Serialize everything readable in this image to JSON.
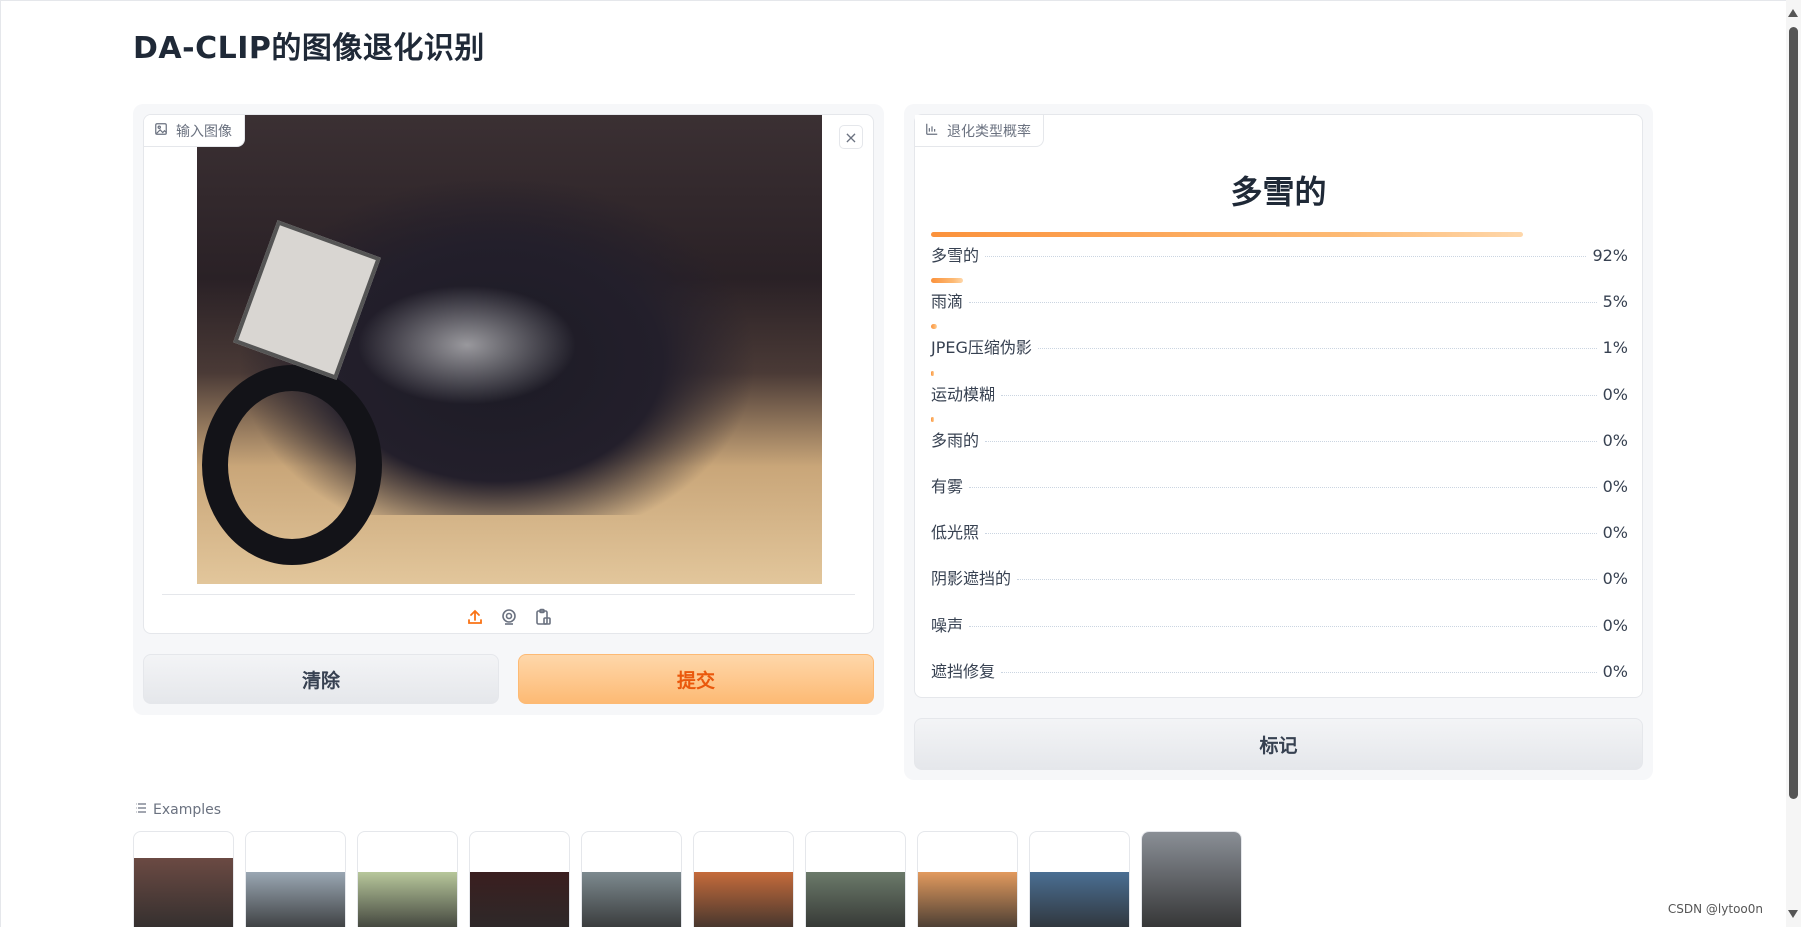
{
  "app": {
    "title": "DA-CLIP的图像退化识别"
  },
  "input": {
    "label": "输入图像",
    "close_symbol": "×",
    "icons": [
      "image-icon",
      "upload-icon",
      "webcam-icon",
      "clipboard-icon"
    ]
  },
  "buttons": {
    "clear": "清除",
    "submit": "提交",
    "flag": "标记"
  },
  "output": {
    "label": "退化类型概率",
    "top_label": "多雪的",
    "rows": [
      {
        "name": "多雪的",
        "percent": "92%",
        "value": 0.92
      },
      {
        "name": "雨滴",
        "percent": "5%",
        "value": 0.05
      },
      {
        "name": "JPEG压缩伪影",
        "percent": "1%",
        "value": 0.01
      },
      {
        "name": "运动模糊",
        "percent": "0%",
        "value": 0.004
      },
      {
        "name": "多雨的",
        "percent": "0%",
        "value": 0.003
      },
      {
        "name": "有雾",
        "percent": "0%",
        "value": 0
      },
      {
        "name": "低光照",
        "percent": "0%",
        "value": 0
      },
      {
        "name": "阴影遮挡的",
        "percent": "0%",
        "value": 0
      },
      {
        "name": "噪声",
        "percent": "0%",
        "value": 0
      },
      {
        "name": "遮挡修复",
        "percent": "0%",
        "value": 0
      }
    ]
  },
  "examples": {
    "label": "Examples",
    "thumbs": [
      {
        "name": "example-face",
        "color": "#6b4a43"
      },
      {
        "name": "example-palace",
        "color": "#9aa7b3"
      },
      {
        "name": "example-grass",
        "color": "#b7c79b"
      },
      {
        "name": "example-dark",
        "color": "#3a1e1f"
      },
      {
        "name": "example-street",
        "color": "#7d8a8f"
      },
      {
        "name": "example-stairs",
        "color": "#c56b3b"
      },
      {
        "name": "example-blur",
        "color": "#6b7a6a"
      },
      {
        "name": "example-orange",
        "color": "#e29a5e"
      },
      {
        "name": "example-trees",
        "color": "#4a6f93"
      },
      {
        "name": "example-sailboats",
        "color": "#8a8f96"
      }
    ]
  },
  "watermark": "CSDN @lytoo0n",
  "colors": {
    "accent": "#f97316",
    "accent_light": "#fdba74"
  }
}
